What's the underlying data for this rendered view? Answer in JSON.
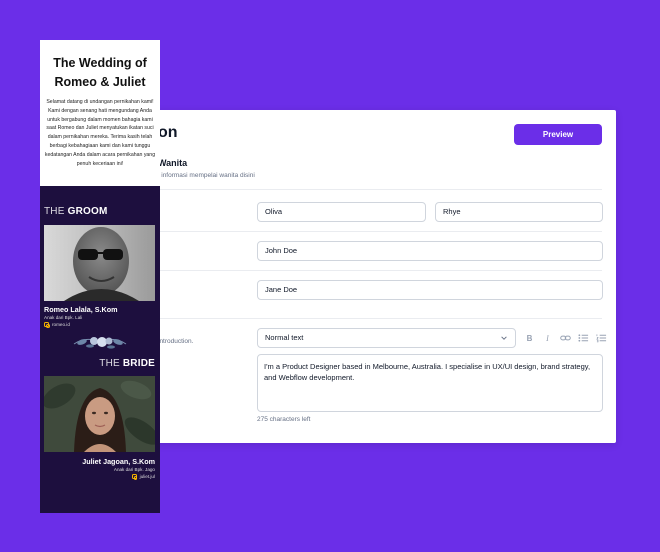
{
  "colors": {
    "background": "#6b2ee8",
    "accent": "#6b2ee8",
    "invite_dark": "#1d0f3e"
  },
  "form": {
    "title_fragment": "on",
    "preview_label": "Preview",
    "section_title": "Wanita",
    "section_subtitle": "l informasi mempelai wanita disini",
    "first_name": "Oliva",
    "last_name": "Rhye",
    "father": "John Doe",
    "mother": "Jane Doe",
    "bio_label_fragment": "introduction.",
    "text_style": "Normal text",
    "bio": "I'm a Product Designer based in Melbourne, Australia. I specialise in UX/UI design, brand strategy, and Webflow development.",
    "chars_left": "275 characters left"
  },
  "invitation": {
    "title": "The Wedding of Romeo & Juliet",
    "body": "Selamat datang di undangan pernikahan kami! Kami dengan senang hati mengundang Anda untuk bergabung dalam momen bahagia kami saat Romeo dan Juliet menyatukan ikatan suci dalam pernikahan mereka. Terima kasih telah berbagi kebahagiaan kami dan kami tunggu kedatangan Anda dalam acara pernikahan yang penuh keceriaan ini!",
    "groom": {
      "head_thin": "THE",
      "head_bold": "GROOM",
      "name": "Romeo Lalala, S.Kom",
      "parents": "Anak dari Bpk. Lali",
      "ig": "romeo.id"
    },
    "bride": {
      "head_thin": "THE",
      "head_bold": "BRIDE",
      "name": "Juliet Jagoan, S.Kom",
      "parents": "Anak dari Bpk. Jago",
      "ig": "juliet.jul"
    }
  }
}
